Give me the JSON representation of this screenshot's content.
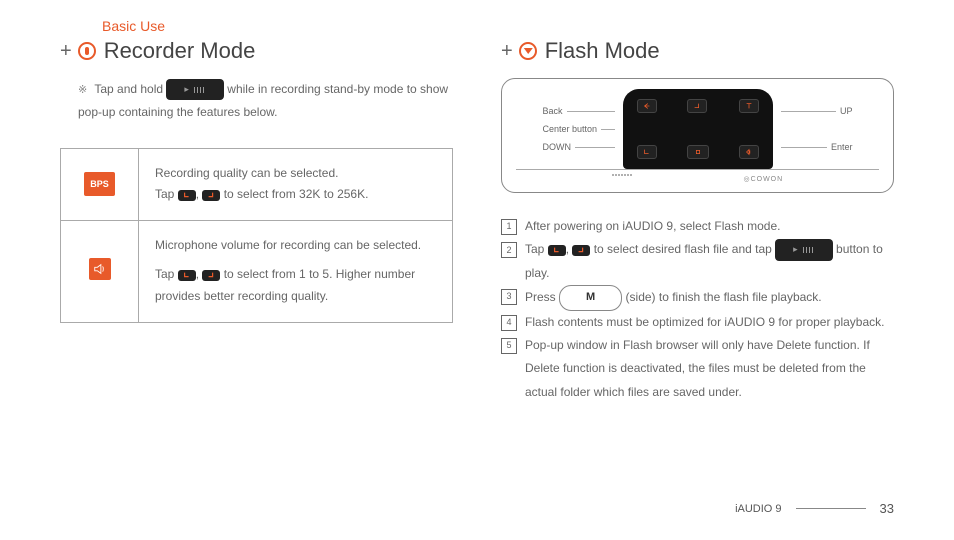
{
  "breadcrumb": "Basic Use",
  "left": {
    "heading": "Recorder Mode",
    "intro_pre": "Tap and hold ",
    "intro_post": " while in recording stand-by mode to show pop-up containing the features below.",
    "row1_badge": "BPS",
    "row1_line1": "Recording quality can be selected.",
    "row1_line2a": "Tap ",
    "row1_line2b": " to select from 32K to 256K.",
    "row2_line1": "Microphone volume for recording can be selected.",
    "row2_line2a": "Tap ",
    "row2_line2b": " to select from 1 to 5. Higher number provides better recording quality."
  },
  "right": {
    "heading": "Flash Mode",
    "labels": {
      "back": "Back",
      "center": "Center button",
      "down": "DOWN",
      "up": "UP",
      "enter": "Enter"
    },
    "brand": "COWON",
    "s1": "After powering on iAUDIO 9, select Flash mode.",
    "s2a": "Tap ",
    "s2b": " to select desired flash file and tap ",
    "s2c": " button to play.",
    "s3a": "Press ",
    "s3m": "M",
    "s3b": " (side) to finish the flash file playback.",
    "s4": "Flash contents must be optimized for iAUDIO 9 for proper playback.",
    "s5": "Pop-up window in Flash browser will only have Delete function. If Delete function is deactivated, the files must be deleted from the actual folder which files are saved under."
  },
  "footer": {
    "product": "iAUDIO 9",
    "page": "33"
  }
}
